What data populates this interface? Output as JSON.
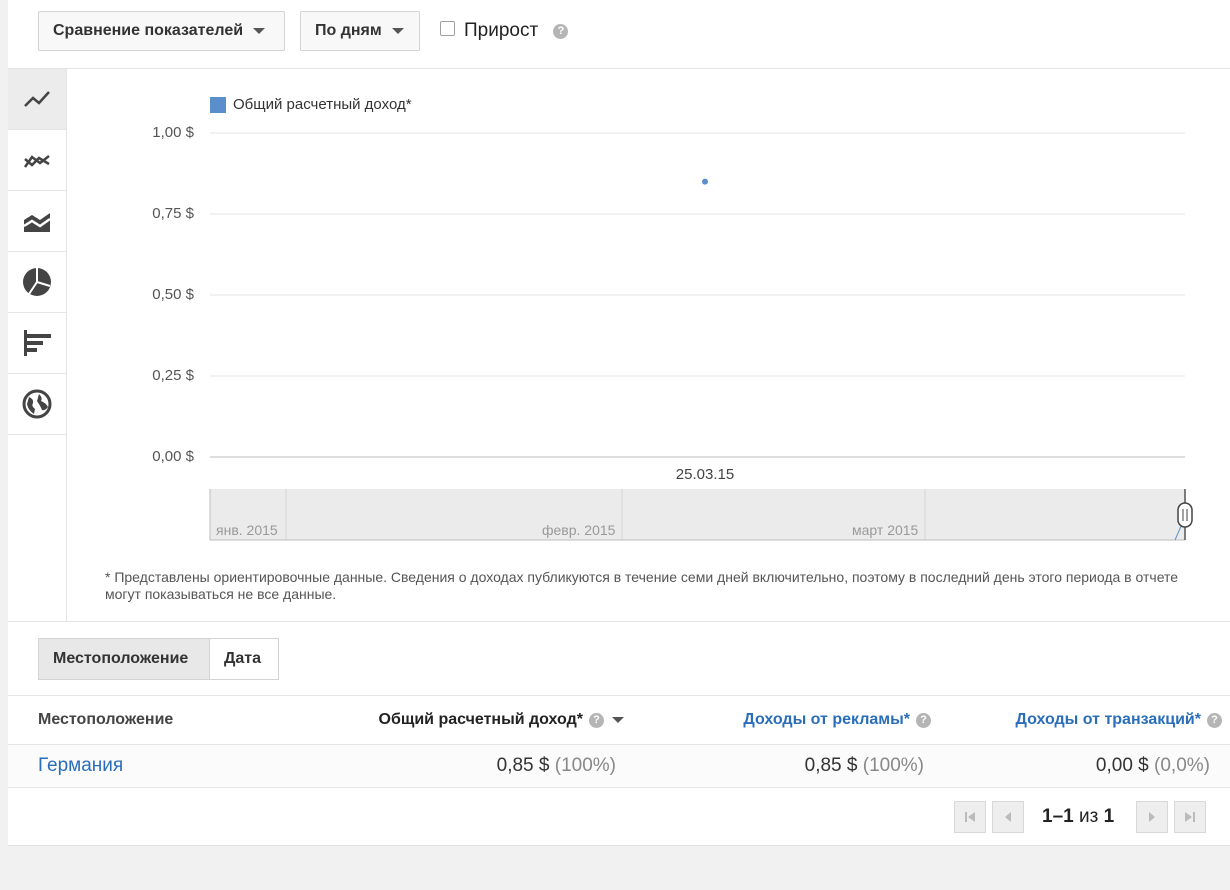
{
  "toolbar": {
    "compare_label": "Сравнение показателей",
    "period_label": "По дням",
    "growth_label": "Прирост",
    "help": "?"
  },
  "side_icons": [
    "line-chart-icon",
    "multi-line-chart-icon",
    "area-chart-icon",
    "pie-chart-icon",
    "bar-chart-icon",
    "globe-icon"
  ],
  "chart_data": {
    "type": "scatter",
    "legend": "Общий расчетный доход*",
    "series": [
      {
        "name": "Общий расчетный доход*",
        "x": [
          "25.03.15"
        ],
        "values": [
          0.85
        ]
      }
    ],
    "ylim": [
      0,
      1
    ],
    "yticks": [
      "1,00 $",
      "0,75 $",
      "0,50 $",
      "0,25 $",
      "0,00 $"
    ],
    "xtick": "25.03.15",
    "timeline_labels": [
      "янв. 2015",
      "февр. 2015",
      "март 2015"
    ],
    "grid": true,
    "legend_position": "top-left",
    "color": "#5b8fcc"
  },
  "note": "* Представлены ориентировочные данные. Сведения о доходах публикуются в течение семи дней включительно, поэтому в последний день этого периода в отчете могут показываться не все данные.",
  "tabs": {
    "location": "Местоположение",
    "date": "Дата"
  },
  "table": {
    "headers": {
      "location": "Местоположение",
      "total": "Общий расчетный доход*",
      "ads": "Доходы от рекламы*",
      "transactions": "Доходы от транзакций*"
    },
    "row": {
      "location": "Германия",
      "total_value": "0,85 $",
      "total_pct": "(100%)",
      "ads_value": "0,85 $",
      "ads_pct": "(100%)",
      "trans_value": "0,00 $",
      "trans_pct": "(0,0%)"
    }
  },
  "pagination": {
    "range": "1–1",
    "of": "из",
    "total": "1"
  }
}
